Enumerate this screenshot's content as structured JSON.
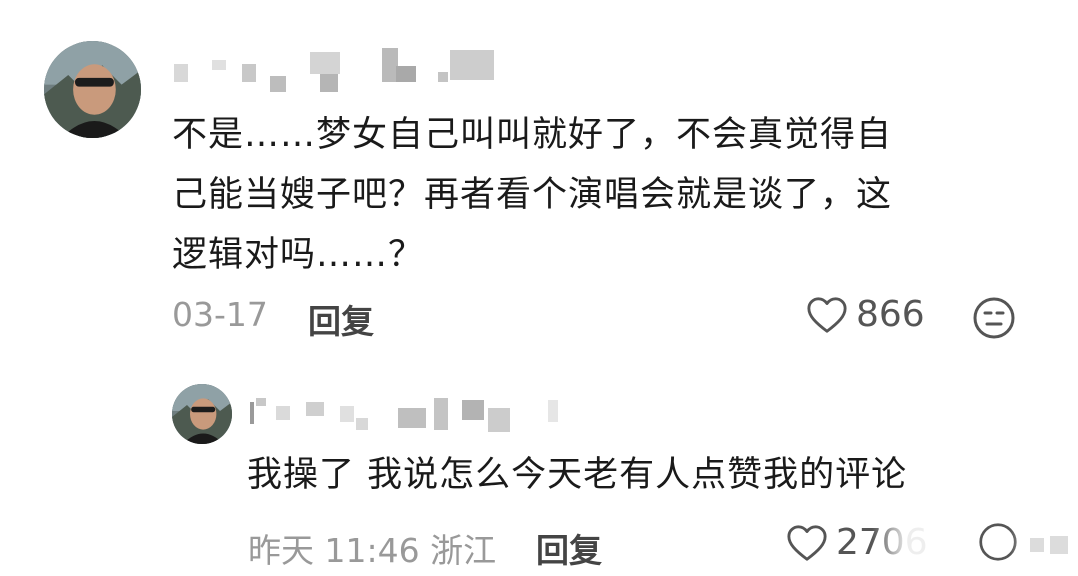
{
  "comment": {
    "text_line1": "不是……梦女自己叫叫就好了，不会真觉得自",
    "text_line2": "己能当嫂子吧？再者看个演唱会就是谈了，这",
    "text_line3": "逻辑对吗……？",
    "date": "03-17",
    "reply_label": "回复",
    "like_count": "866",
    "icons": {
      "avatar": "avatar",
      "heart": "heart-icon",
      "face": "face-icon"
    }
  },
  "reply": {
    "text": "我操了 我说怎么今天老有人点赞我的评论",
    "date_location": "昨天 11:46 浙江",
    "reply_label": "回复",
    "like_count": "2706",
    "icons": {
      "avatar": "avatar",
      "heart": "heart-icon",
      "face": "face-icon"
    }
  },
  "colors": {
    "text_primary": "#1a1a1a",
    "text_meta": "#999999",
    "reply_label": "#444444",
    "icon": "#555555"
  }
}
